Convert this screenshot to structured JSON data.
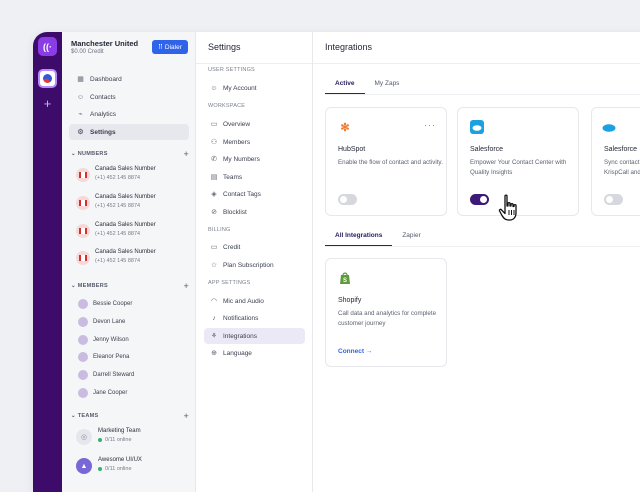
{
  "workspace": {
    "name": "Manchester United",
    "credit": "$0.00 Credit",
    "dialer_label": "Dialer"
  },
  "sidebar": {
    "nav": [
      {
        "label": "Dashboard",
        "icon": "dashboard-icon"
      },
      {
        "label": "Contacts",
        "icon": "contacts-icon"
      },
      {
        "label": "Analytics",
        "icon": "analytics-icon"
      },
      {
        "label": "Settings",
        "icon": "gear-icon",
        "active": true
      }
    ],
    "numbers_header": "NUMBERS",
    "numbers": [
      {
        "name": "Canada Sales Number",
        "phone": "(+1) 452 145 8874"
      },
      {
        "name": "Canada Sales Number",
        "phone": "(+1) 452 145 8874"
      },
      {
        "name": "Canada Sales Number",
        "phone": "(+1) 452 145 8874"
      },
      {
        "name": "Canada Sales Number",
        "phone": "(+1) 452 145 8874"
      }
    ],
    "members_header": "MEMBERS",
    "members": [
      "Bessie Cooper",
      "Devon Lane",
      "Jenny Wilson",
      "Eleanor Pena",
      "Darrell Steward",
      "Jane Cooper"
    ],
    "teams_header": "TEAMS",
    "teams": [
      {
        "name": "Marketing Team",
        "online": "0/11 online"
      },
      {
        "name": "Awesome UI/UX",
        "online": "0/11 online"
      }
    ]
  },
  "settings": {
    "title": "Settings",
    "user_settings_header": "USER SETTINGS",
    "my_account": "My Account",
    "workspace_header": "WORKSPACE",
    "workspace_items": [
      "Overview",
      "Members",
      "My Numbers",
      "Teams",
      "Contact Tags",
      "Blocklist"
    ],
    "billing_header": "BILLING",
    "billing_items": [
      "Credit",
      "Plan Subscription"
    ],
    "app_settings_header": "APP SETTINGS",
    "app_items": [
      "Mic and Audio",
      "Notifications",
      "Integrations",
      "Language"
    ]
  },
  "integrations": {
    "title": "Integrations",
    "top_tabs": [
      "Active",
      "My Zaps"
    ],
    "cards": [
      {
        "name": "HubSpot",
        "desc": "Enable the flow of contact and activity.",
        "enabled": false,
        "icon": "hubspot-icon"
      },
      {
        "name": "Salesforce",
        "desc": "Empower Your Contact Center with Quality Insights",
        "enabled": true,
        "icon": "salesforce-icon"
      },
      {
        "name": "Salesforce",
        "desc": "Sync contact KrispCall and",
        "enabled": false,
        "icon": "salesforce-icon"
      }
    ],
    "sub_tabs": [
      "All Integrations",
      "Zapier"
    ],
    "shopify": {
      "name": "Shopify",
      "desc": "Call data and analytics for complete customer journey",
      "connect": "Connect"
    }
  },
  "colors": {
    "rail": "#3d0c6b",
    "accent": "#3d1a7a",
    "primary_button": "#2f63ea"
  }
}
